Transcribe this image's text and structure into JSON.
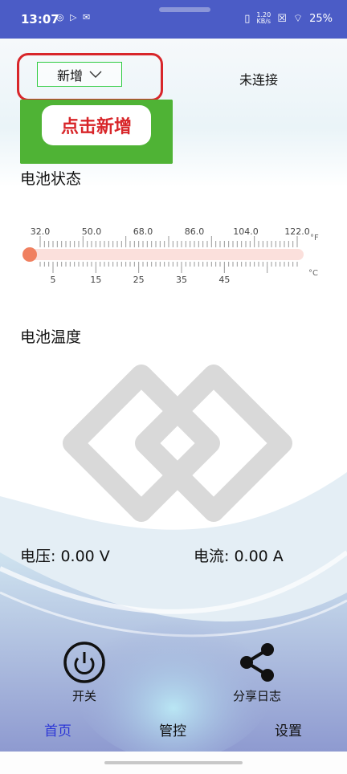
{
  "status_bar": {
    "time": "13:07",
    "left_icons": "◎ ▷ ✉",
    "speed_value": "1.20",
    "speed_unit": "KB/s",
    "battery": "25%"
  },
  "device_selector": {
    "label": "新增"
  },
  "connection_status": "未连接",
  "callout": "点击新增",
  "battery_status_label": "电池状态",
  "thermometer": {
    "fahrenheit_ticks": [
      "32.0",
      "50.0",
      "68.0",
      "86.0",
      "104.0",
      "122.0"
    ],
    "fahrenheit_unit": "°F",
    "celsius_ticks": [
      "5",
      "15",
      "25",
      "35",
      "45"
    ],
    "celsius_unit": "°C",
    "value_fraction": 0
  },
  "temperature_label": "电池温度",
  "voltage": "电压: 0.00 V",
  "current": "电流: 0.00 A",
  "actions": {
    "power": "开关",
    "share": "分享日志"
  },
  "tabs": [
    {
      "label": "首页",
      "active": true
    },
    {
      "label": "管控",
      "active": false
    },
    {
      "label": "设置",
      "active": false
    }
  ],
  "colors": {
    "accent": "#2c36d6",
    "battery_green": "#4fb335",
    "highlight_red": "#d8262a",
    "thermo_bulb": "#f08060"
  }
}
